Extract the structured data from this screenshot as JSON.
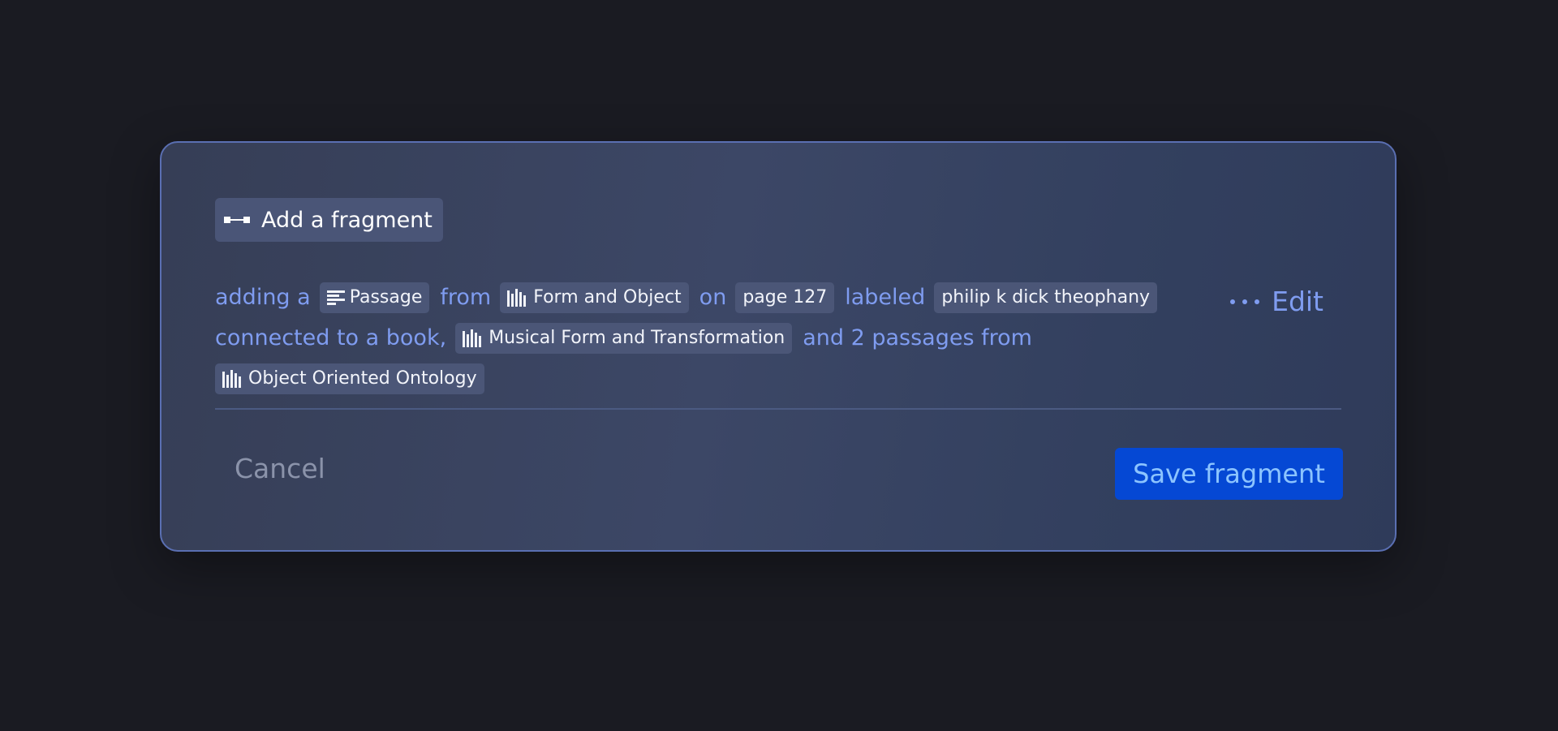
{
  "dialog": {
    "title": "Add a fragment",
    "title_icon": "fragment-icon",
    "sentence": {
      "line1": {
        "w1": "adding a",
        "chip_type": "Passage",
        "chip_type_icon": "passage-icon",
        "w2": "from",
        "chip_source": "Form and Object",
        "chip_source_icon": "library-icon",
        "w3": "on",
        "chip_page": "page 127",
        "w4": "labeled",
        "chip_label": "philip k dick theophany"
      },
      "line2": {
        "w1": "connected to a book,",
        "chip_book": "Musical Form and Transformation",
        "chip_book_icon": "library-icon",
        "w2": "and 2 passages from"
      },
      "line3": {
        "chip_source": "Object Oriented Ontology",
        "chip_source_icon": "library-icon"
      }
    },
    "edit": {
      "label": "Edit",
      "icon": "more-dots-icon"
    },
    "cancel_label": "Cancel",
    "save_label": "Save fragment"
  },
  "colors": {
    "background": "#1a1b22",
    "card_border": "#5a6fb2",
    "accent_text": "#7f9cf0",
    "chip_bg": "#4b5677",
    "save_bg": "#0548d4",
    "save_text": "#8cc4ff",
    "cancel_text": "#8b93aa"
  }
}
